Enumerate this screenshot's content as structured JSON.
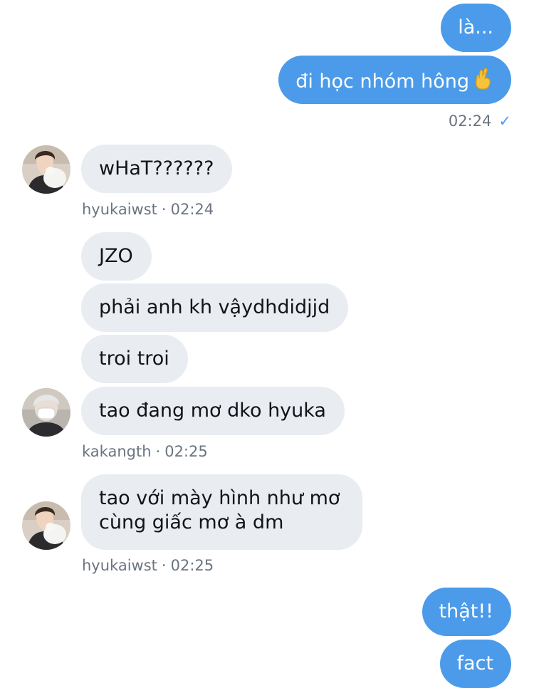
{
  "conversation": {
    "messages": [
      {
        "direction": "out",
        "text": "là..."
      },
      {
        "direction": "out",
        "text": "đi học nhóm hông",
        "emoji": "crossed-fingers"
      },
      {
        "direction": "in",
        "text": "wHaT??????"
      },
      {
        "direction": "in",
        "text": "JZO"
      },
      {
        "direction": "in",
        "text": "phải anh kh vậydhdidjjd"
      },
      {
        "direction": "in",
        "text": "troi troi"
      },
      {
        "direction": "in",
        "text": "tao đang mơ dko hyuka"
      },
      {
        "direction": "in",
        "lines": [
          "tao với mày hình như mơ",
          "cùng giấc mơ à dm"
        ]
      },
      {
        "direction": "out",
        "text": "thật!!"
      },
      {
        "direction": "out",
        "text": "fact"
      }
    ],
    "meta": {
      "out_time_1": "02:24",
      "out_status": "sent-check",
      "group1_user": "hyukaiwst",
      "group1_time": "02:24",
      "group2_user": "kakangth",
      "group2_time": "02:25",
      "group3_user": "hyukaiwst",
      "group3_time": "02:25",
      "separator": "·",
      "check_glyph": "✓"
    }
  },
  "colors": {
    "outgoing_bubble": "#4b9bea",
    "incoming_bubble": "#e9ecf1",
    "meta_text": "#6b7480"
  }
}
